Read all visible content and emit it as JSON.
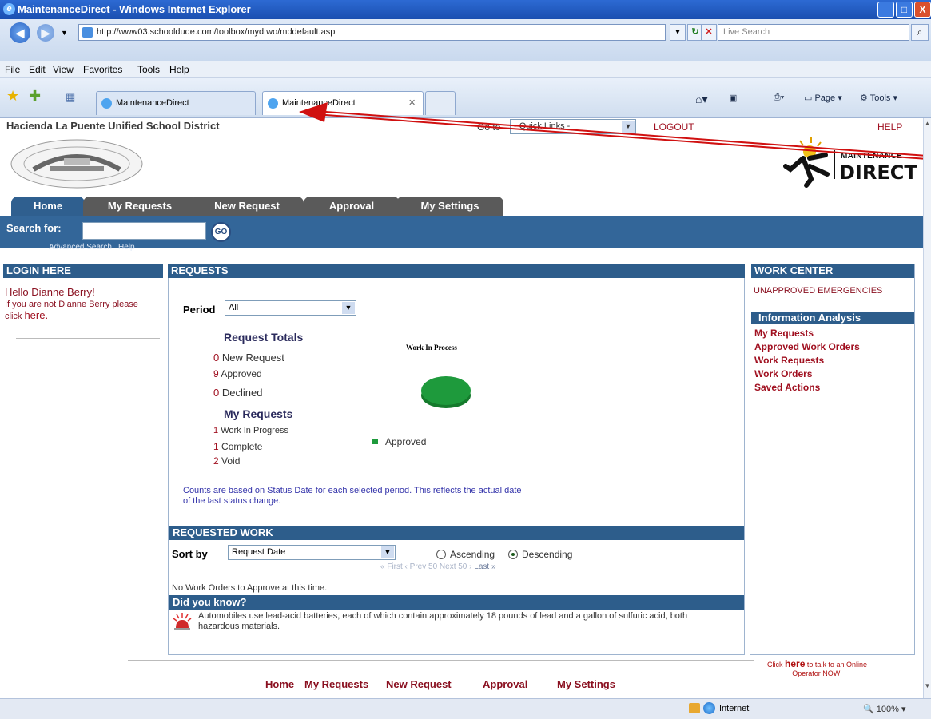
{
  "window": {
    "title": "MaintenanceDirect - Windows Internet Explorer",
    "minimize": "_",
    "maximize": "□",
    "close": "X"
  },
  "browser": {
    "url": "http://www03.schooldude.com/toolbox/mydtwo/mddefault.asp",
    "search_placeholder": "Live Search",
    "menu": [
      "File",
      "Edit",
      "View",
      "Favorites",
      "Tools",
      "Help"
    ],
    "tabs": [
      "MaintenanceDirect",
      "MaintenanceDirect"
    ],
    "commands": {
      "page": "Page",
      "tools": "Tools"
    },
    "status_zone": "Internet",
    "zoom": "100%"
  },
  "header": {
    "district": "Hacienda La Puente Unified School District",
    "goto_label": "Go to",
    "quick_links": "- Quick Links -",
    "logout": "LOGOUT",
    "help": "HELP",
    "logo_line1": "MAINTENANCE",
    "logo_line2": "DIRECT"
  },
  "app_tabs": [
    "Home",
    "My Requests",
    "New Request",
    "Approval",
    "My Settings"
  ],
  "search": {
    "label": "Search for:",
    "go": "GO",
    "advanced": "Advanced Search",
    "help": "Help"
  },
  "login_panel": {
    "title": "LOGIN HERE",
    "greeting": "Hello Dianne Berry!",
    "message_prefix": "If you are not Dianne Berry please click",
    "message_link": "here."
  },
  "requests_panel": {
    "title": "REQUESTS",
    "period_label": "Period",
    "period_value": "All",
    "totals_heading": "Request Totals",
    "totals": [
      {
        "count": "0",
        "label": "New Request"
      },
      {
        "count": "9",
        "label": "Approved"
      },
      {
        "count": "0",
        "label": "Declined"
      }
    ],
    "my_heading": "My Requests",
    "my": [
      {
        "count": "1",
        "label": "Work In Progress"
      },
      {
        "count": "1",
        "label": "Complete"
      },
      {
        "count": "2",
        "label": "Void"
      }
    ],
    "note": "Counts are based on Status Date for each selected period. This reflects the actual date of the last status change."
  },
  "chart_data": {
    "type": "pie",
    "title": "Work In Process",
    "categories": [
      "Approved"
    ],
    "values": [
      100
    ],
    "colors": [
      "#1e9a3c"
    ],
    "legend_placement": "bottom-left"
  },
  "requested_work": {
    "title": "REQUESTED WORK",
    "sort_label": "Sort by",
    "sort_value": "Request Date",
    "ascending": "Ascending",
    "descending": "Descending",
    "selected_order": "Descending",
    "pager": "« First ‹ Prev 50 Next 50 ›",
    "pager_last": "Last »",
    "empty_message": "No Work Orders to Approve at this time."
  },
  "did_you_know": {
    "title": "Did you know?",
    "fact": "Automobiles use lead-acid batteries, each of which contain approximately 18 pounds of lead and a gallon of sulfuric acid, both hazardous materials."
  },
  "work_center": {
    "title": "WORK CENTER",
    "item": "UNAPPROVED EMERGENCIES",
    "analysis_title": "Information Analysis",
    "links": [
      "My Requests",
      "Approved Work Orders",
      "Work Requests",
      "Work Orders",
      "Saved Actions"
    ]
  },
  "footer": {
    "links": [
      "Home",
      "My Requests",
      "New Request",
      "Approval",
      "My Settings"
    ],
    "operator_pre": "Click",
    "operator_link": "here",
    "operator_post": "to talk to an Online Operator NOW!"
  },
  "colors": {
    "accent": "#336699",
    "panel_header": "#2d5d8b",
    "link": "#a01020",
    "pie": "#1e9a3c",
    "arrow": "#e01010"
  }
}
